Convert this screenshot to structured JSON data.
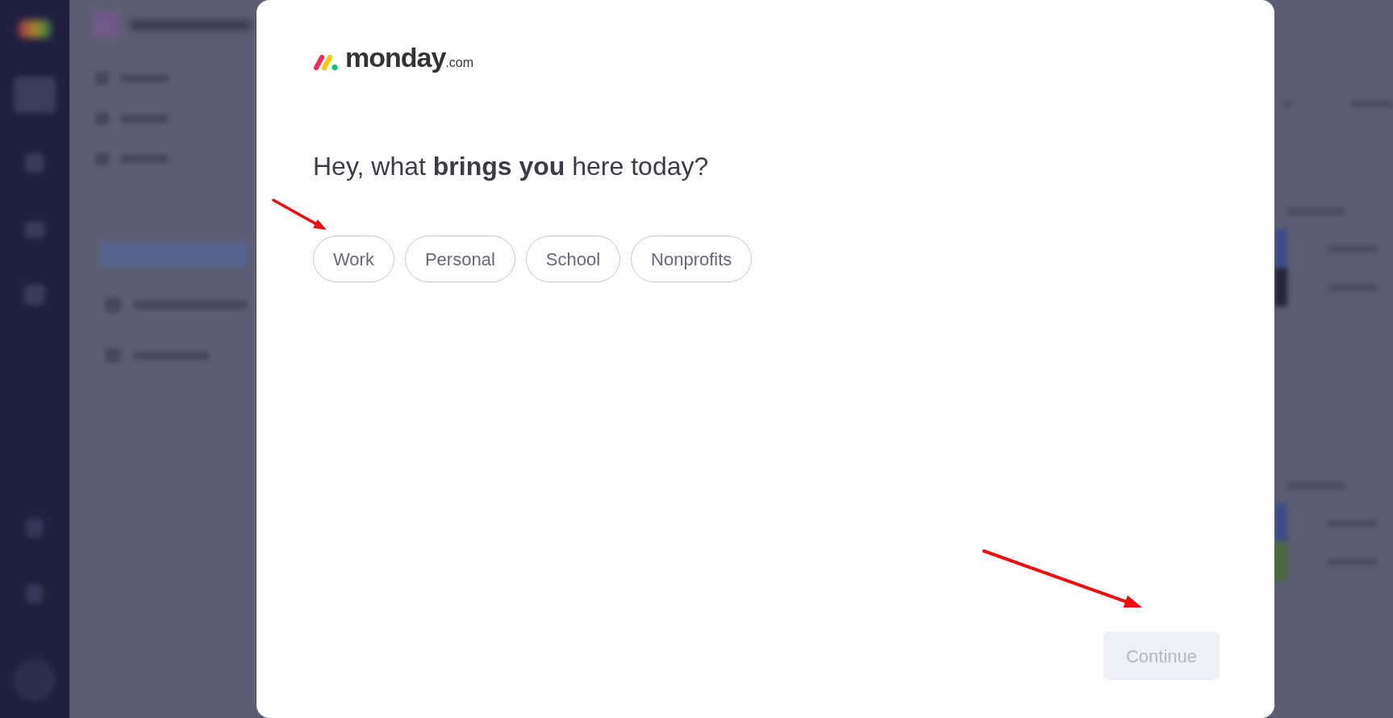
{
  "logo": {
    "wordmark": "monday",
    "suffix": ".com"
  },
  "heading": "Hey, what **brings you** here today?",
  "options": [
    {
      "label": "Work",
      "selected": false
    },
    {
      "label": "Personal",
      "selected": false
    },
    {
      "label": "School",
      "selected": false
    },
    {
      "label": "Nonprofits",
      "selected": false
    }
  ],
  "continue_button": {
    "label": "Continue",
    "disabled": true
  }
}
